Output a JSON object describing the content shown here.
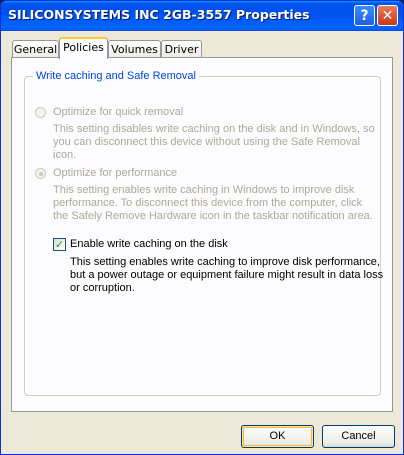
{
  "window": {
    "title": "SILICONSYSTEMS INC 2GB-3557 Properties",
    "help_glyph": "?",
    "close_glyph": "✕"
  },
  "tabs": [
    {
      "label": "General",
      "active": false
    },
    {
      "label": "Policies",
      "active": true
    },
    {
      "label": "Volumes",
      "active": false
    },
    {
      "label": "Driver",
      "active": false
    }
  ],
  "group": {
    "title": "Write caching and Safe Removal",
    "quick_removal": {
      "label": "Optimize for quick removal",
      "selected": false,
      "enabled": false,
      "description": [
        "This setting disables write caching on the disk and in Windows, so",
        "you can disconnect this device without using the Safe Removal",
        "icon."
      ]
    },
    "performance": {
      "label": "Optimize for performance",
      "selected": true,
      "enabled": false,
      "description": [
        "This setting enables write caching in Windows to improve disk",
        "performance. To disconnect this device from the computer, click",
        "the Safely Remove Hardware icon in the taskbar notification area."
      ]
    },
    "write_caching": {
      "label": "Enable write caching on the disk",
      "checked": true,
      "check_glyph": "✓",
      "description": [
        "This setting enables write caching to improve disk performance,",
        "but a power outage or equipment failure might result in data loss",
        "or corruption."
      ]
    }
  },
  "buttons": {
    "ok": "OK",
    "cancel": "Cancel"
  },
  "colors": {
    "title_bar": "#0054e3",
    "group_title": "#0046d5",
    "tab_highlight": "#ffc83c"
  }
}
